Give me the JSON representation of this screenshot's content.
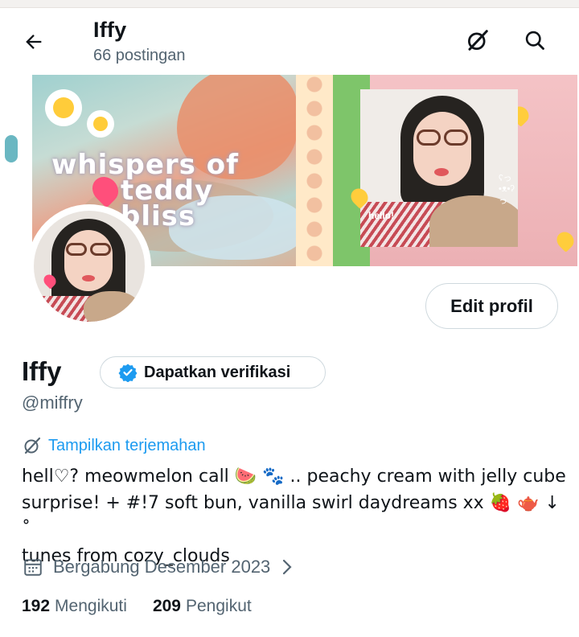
{
  "header": {
    "title": "Iffy",
    "post_count": "66 postingan"
  },
  "banner": {
    "text_line1": "whispers of",
    "text_line2": "teddy bliss",
    "photo_caption": "hello!",
    "photo_mark": "ʕっ•ᴥ•ʔっ"
  },
  "actions": {
    "edit_profile": "Edit profil",
    "get_verified": "Dapatkan verifikasi"
  },
  "profile": {
    "name": "Iffy",
    "handle": "@miffry",
    "translate_link": "Tampilkan terjemahan",
    "bio_line1": "hell♡? meowmelon call 🍉 🐾 .. peachy cream with jelly cube",
    "bio_line2": "surprise! + #!7 soft bun, vanilla swirl daydreams xx 🍓 🫖 ↓ ˚",
    "bio_line3": "tunes from cozy_clouds",
    "joined": "Bergabung Desember 2023",
    "following_count": "192",
    "following_label": "Mengikuti",
    "followers_count": "209",
    "followers_label": "Pengikut"
  },
  "icons": {
    "back": "arrow-left-icon",
    "grok": "grok-icon",
    "search": "search-icon",
    "verified": "verified-badge-icon",
    "translate": "translate-icon",
    "calendar": "calendar-icon",
    "chevron": "chevron-right-icon"
  },
  "colors": {
    "accent": "#1d9bf0",
    "text": "#0f1419",
    "muted": "#536471",
    "border": "#cfd9de"
  }
}
